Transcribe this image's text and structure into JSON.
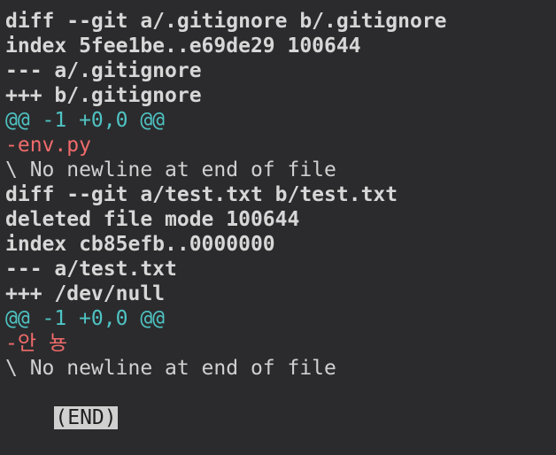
{
  "terminal": {
    "lines": [
      {
        "text": "diff --git a/.gitignore b/.gitignore",
        "kind": "meta"
      },
      {
        "text": "index 5fee1be..e69de29 100644",
        "kind": "meta"
      },
      {
        "text": "--- a/.gitignore",
        "kind": "meta"
      },
      {
        "text": "+++ b/.gitignore",
        "kind": "meta"
      },
      {
        "text": "@@ -1 +0,0 @@",
        "kind": "hunk"
      },
      {
        "text": "-env.py",
        "kind": "del"
      },
      {
        "text": "\\ No newline at end of file",
        "kind": "plain"
      },
      {
        "text": "diff --git a/test.txt b/test.txt",
        "kind": "meta"
      },
      {
        "text": "deleted file mode 100644",
        "kind": "meta"
      },
      {
        "text": "index cb85efb..0000000",
        "kind": "meta"
      },
      {
        "text": "--- a/test.txt",
        "kind": "meta"
      },
      {
        "text": "+++ /dev/null",
        "kind": "meta"
      },
      {
        "text": "@@ -1 +0,0 @@",
        "kind": "hunk"
      },
      {
        "text": "-안 뇽",
        "kind": "del"
      },
      {
        "text": "\\ No newline at end of file",
        "kind": "plain"
      }
    ],
    "pager_prompt": "(END)",
    "colors": {
      "background": "#2b2b2d",
      "meta": "#d7d7d7",
      "hunk": "#4fc3c3",
      "deletion": "#f06b6b",
      "plain": "#d0d0d0"
    }
  }
}
